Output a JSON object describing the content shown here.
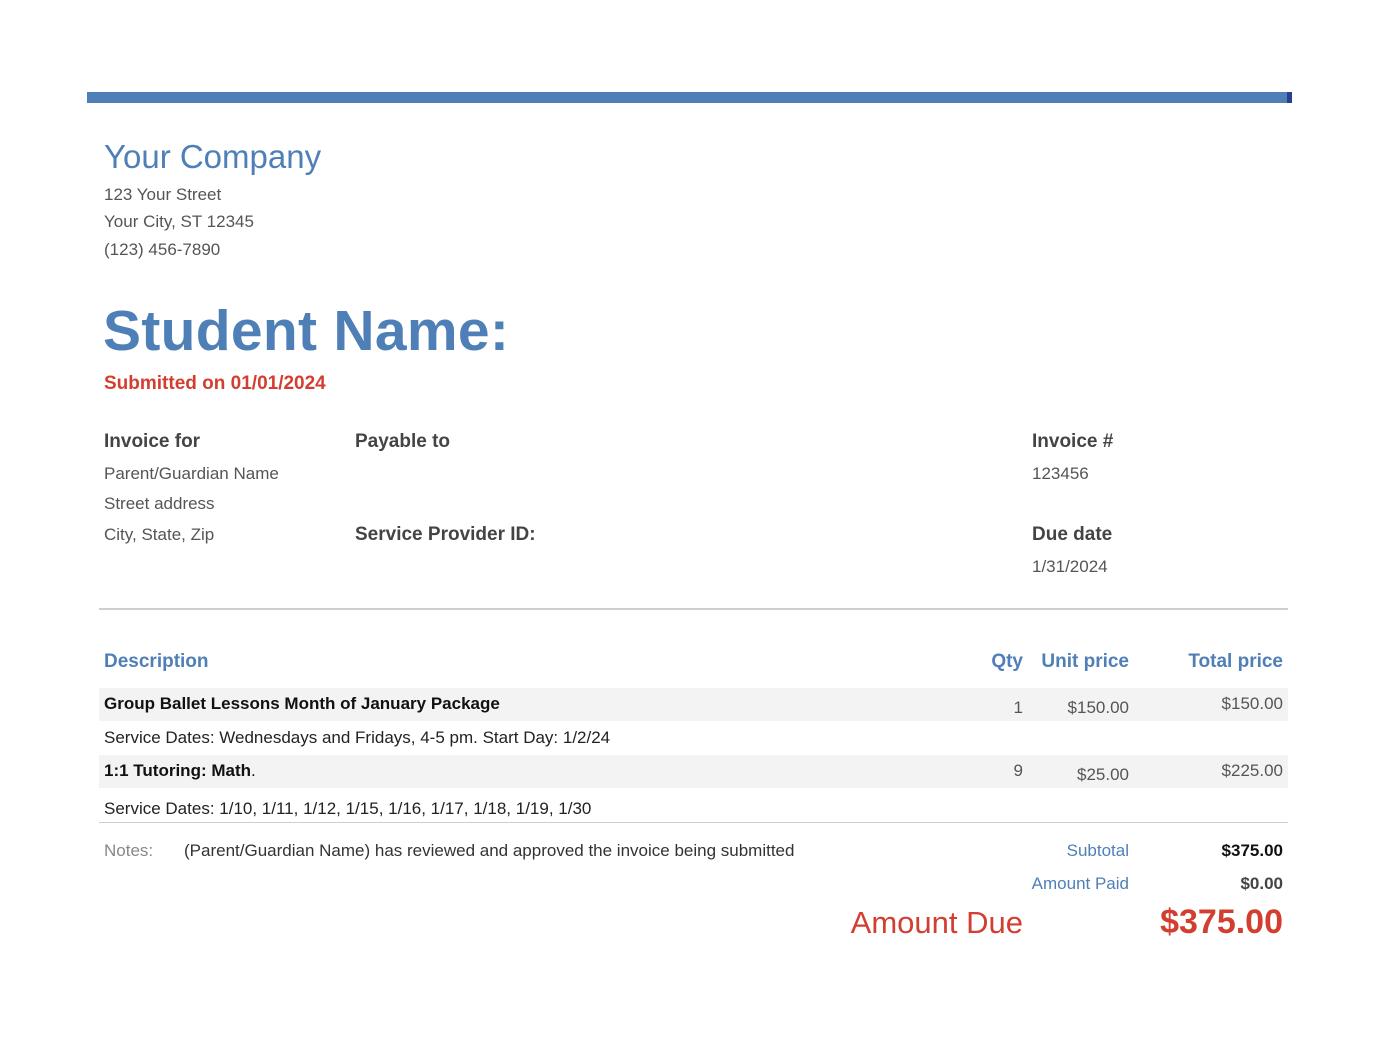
{
  "company": {
    "name": "Your Company",
    "street": "123 Your Street",
    "city": "Your City, ST 12345",
    "phone": "(123) 456-7890"
  },
  "student_title": "Student Name:",
  "submitted": "Submitted on 01/01/2024",
  "invoice_for": {
    "label": "Invoice for",
    "name": "Parent/Guardian Name",
    "street": "Street address",
    "city": "City, State, Zip"
  },
  "payable_to": {
    "label": "Payable to"
  },
  "service_provider": {
    "label": "Service Provider ID:"
  },
  "invoice_number": {
    "label": "Invoice #",
    "value": "123456"
  },
  "due_date": {
    "label": "Due date",
    "value": "1/31/2024"
  },
  "table": {
    "headers": {
      "description": "Description",
      "qty": "Qty",
      "unit_price": "Unit price",
      "total_price": "Total price"
    },
    "items": [
      {
        "title": "Group Ballet Lessons Month of January Package",
        "title_suffix": "",
        "detail": "Service Dates: Wednesdays and Fridays, 4-5 pm. Start Day: 1/2/24",
        "qty": "1",
        "unit_price": "$150.00",
        "total_price": "$150.00"
      },
      {
        "title": "1:1 Tutoring: Math",
        "title_suffix": ".",
        "detail": "Service Dates: 1/10, 1/11, 1/12, 1/15, 1/16, 1/17, 1/18, 1/19, 1/30",
        "qty": "9",
        "unit_price": "$25.00",
        "total_price": "$225.00"
      }
    ]
  },
  "notes": {
    "label": "Notes:",
    "text": "(Parent/Guardian Name) has reviewed and approved the invoice being submitted"
  },
  "summary": {
    "subtotal_label": "Subtotal",
    "subtotal": "$375.00",
    "paid_label": "Amount Paid",
    "paid": "$0.00",
    "due_label": "Amount Due",
    "due": "$375.00"
  },
  "colors": {
    "accent": "#4f7fb7",
    "due_red": "#d23f31",
    "row_bg": "#f3f3f3"
  }
}
